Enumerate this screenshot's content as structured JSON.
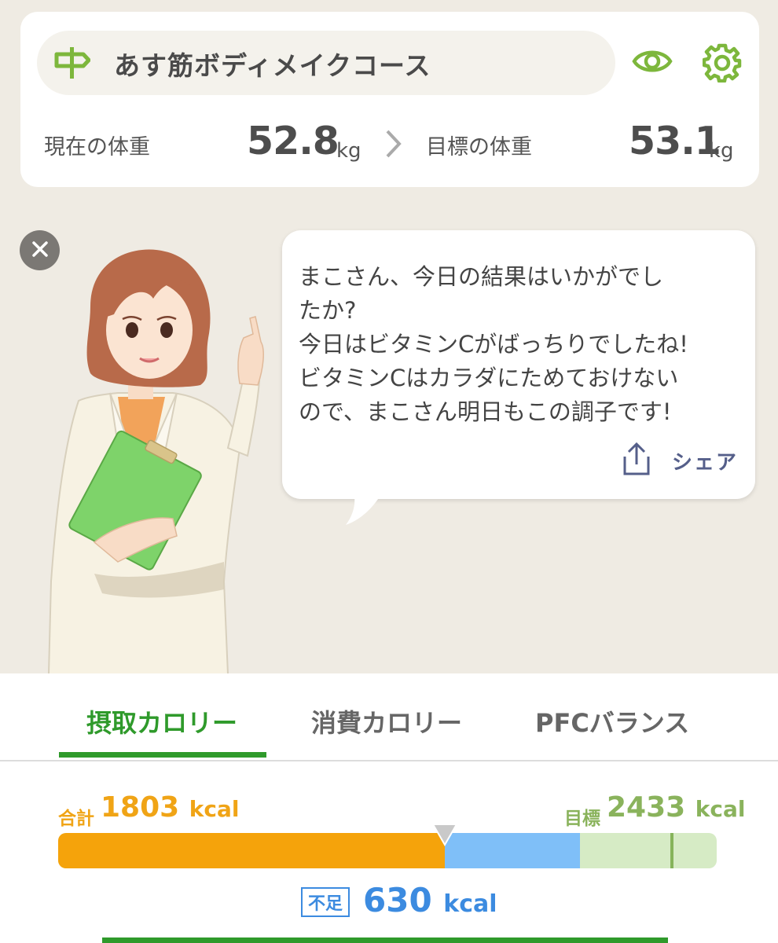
{
  "course": {
    "name": "あす筋ボディメイクコース",
    "current_weight_label": "現在の体重",
    "current_weight_value": "52.8",
    "target_weight_label": "目標の体重",
    "target_weight_value": "53.1",
    "weight_unit": "kg"
  },
  "message": {
    "lines": [
      "まこさん、今日の結果はいかがでし",
      "たか?",
      "今日はビタミンCがばっちりでしたね!",
      "ビタミンCはカラダにためておけない",
      "ので、まこさん明日もこの調子です!"
    ],
    "share_label": "シェア"
  },
  "tabs": [
    {
      "label": "摂取カロリー",
      "active": true
    },
    {
      "label": "消費カロリー",
      "active": false
    },
    {
      "label": "PFCバランス",
      "active": false
    }
  ],
  "calories": {
    "total_label": "合計",
    "total_value": "1803",
    "goal_label": "目標",
    "goal_value": "2433",
    "unit": "kcal",
    "deficit_label": "不足",
    "deficit_value": "630",
    "bar_scale_max": 3070
  },
  "colors": {
    "accent_green": "#2f9a2b",
    "intake_orange": "#f5a30b",
    "deficit_blue": "#7fbff8",
    "goal_green": "#8ab35c"
  },
  "icons": {
    "course": "signpost-icon",
    "visibility": "eye-icon",
    "settings": "gear-icon",
    "close": "close-icon",
    "share": "share-icon"
  }
}
